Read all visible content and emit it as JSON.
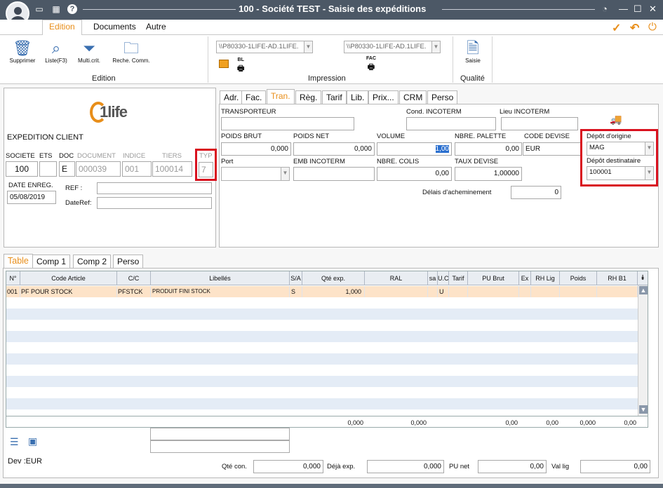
{
  "window": {
    "title": "100 - Société TEST - Saisie des expéditions"
  },
  "ribbon_tabs": [
    "Edition",
    "Documents",
    "Autre"
  ],
  "ribbon": {
    "edition_buttons": [
      "Supprimer",
      "Liste(F3)",
      "Multi.crit.",
      "Reche. Comm."
    ],
    "edition_group": "Edition",
    "printer1": "\\\\P80330-1LIFE-AD.1LIFE.",
    "printer2": "\\\\P80330-1LIFE-AD.1LIFE.",
    "bl_label": "BL",
    "fac_label": "FAC",
    "impression_group": "Impression",
    "saisie_label": "Saisie",
    "qualite_group": "Qualité"
  },
  "header": {
    "logo_text": "1life",
    "doc_type": "EXPEDITION CLIENT",
    "labels": {
      "societe": "SOCIETE",
      "ets": "ETS",
      "doc": "DOC",
      "document": "DOCUMENT",
      "indice": "INDICE",
      "tiers": "TIERS",
      "typ": "TYP",
      "date_enreg": "DATE ENREG.",
      "ref": "REF :",
      "dateref": "DateRef:"
    },
    "values": {
      "societe": "100",
      "ets": "",
      "doc": "E",
      "document": "000039",
      "indice": "001",
      "tiers": "100014",
      "typ": "7",
      "date_enreg": "05/08/2019",
      "ref": "",
      "dateref": ""
    }
  },
  "detail_tabs": [
    "Adr.",
    "Fac.",
    "Tran.",
    "Règ.",
    "Tarif",
    "Lib.",
    "Prix...",
    "CRM",
    "Perso"
  ],
  "transport": {
    "transporteur_label": "TRANSPORTEUR",
    "transporteur": "",
    "cond_incoterm_label": "Cond. INCOTERM",
    "cond_incoterm": "",
    "lieu_incoterm_label": "Lieu INCOTERM",
    "lieu_incoterm": "",
    "poids_brut_label": "POIDS BRUT",
    "poids_brut": "0,000",
    "poids_net_label": "POIDS NET",
    "poids_net": "0,000",
    "volume_label": "VOLUME",
    "volume": "1,00",
    "nbre_palette_label": "NBRE. PALETTE",
    "nbre_palette": "0,00",
    "code_devise_label": "CODE DEVISE",
    "code_devise": "EUR",
    "port_label": "Port",
    "port": "",
    "emb_incoterm_label": "EMB INCOTERM",
    "emb_incoterm": "",
    "nbre_colis_label": "NBRE. COLIS",
    "nbre_colis": "0,00",
    "taux_devise_label": "TAUX DEVISE",
    "taux_devise": "1,00000",
    "delais_label": "Délais d'acheminement",
    "delais": "0",
    "depot_origine_label": "Dépôt d'origine",
    "depot_origine": "MAG",
    "depot_dest_label": "Dépôt destinataire",
    "depot_dest": "100001"
  },
  "grid_tabs": [
    "Table",
    "Comp 1",
    "Comp 2",
    "Perso"
  ],
  "grid": {
    "columns": [
      "N°",
      "Code Article",
      "C/C",
      "Libellés",
      "S/A",
      "Qté exp.",
      "RAL",
      "sa",
      "U.C",
      "Tarif",
      "PU Brut",
      "Ex",
      "RH Lig",
      "Poids",
      "RH B1"
    ],
    "row": {
      "n": "001",
      "code": "PF POUR STOCK",
      "cc": "PFSTCK",
      "lib": "PRODUIT FINI STOCK",
      "sa": "S",
      "qte": "1,000",
      "uc": "U"
    },
    "totals": {
      "qte": "0,000",
      "ral": "0,000",
      "pu": "0,00",
      "rh": "0,00",
      "poids": "0,000",
      "rhb1": "0,00"
    }
  },
  "footer": {
    "dev": "Dev :EUR",
    "qte_con_label": "Qté con.",
    "qte_con": "0,000",
    "deja_exp_label": "Déjà exp.",
    "deja_exp": "0,000",
    "pu_net_label": "PU net",
    "pu_net": "0,00",
    "val_lig_label": "Val lig",
    "val_lig": "0,00"
  },
  "colors": {
    "accent": "#e88e1a",
    "highlight": "#d9121f",
    "selected_row": "#fde3c8"
  }
}
